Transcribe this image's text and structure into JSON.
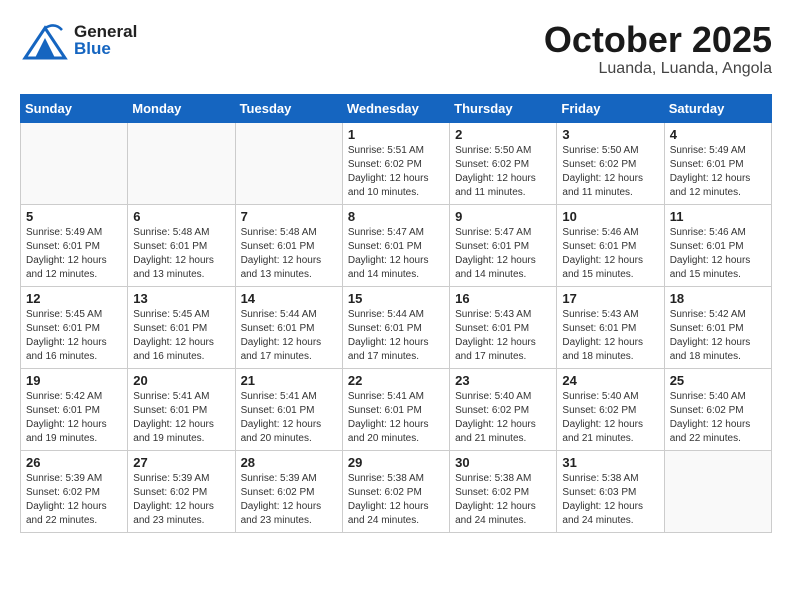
{
  "header": {
    "logo": {
      "general": "General",
      "blue": "Blue"
    },
    "title": "October 2025",
    "location": "Luanda, Luanda, Angola"
  },
  "weekdays": [
    "Sunday",
    "Monday",
    "Tuesday",
    "Wednesday",
    "Thursday",
    "Friday",
    "Saturday"
  ],
  "weeks": [
    [
      {
        "day": "",
        "sunrise": "",
        "sunset": "",
        "daylight": ""
      },
      {
        "day": "",
        "sunrise": "",
        "sunset": "",
        "daylight": ""
      },
      {
        "day": "",
        "sunrise": "",
        "sunset": "",
        "daylight": ""
      },
      {
        "day": "1",
        "sunrise": "Sunrise: 5:51 AM",
        "sunset": "Sunset: 6:02 PM",
        "daylight": "Daylight: 12 hours and 10 minutes."
      },
      {
        "day": "2",
        "sunrise": "Sunrise: 5:50 AM",
        "sunset": "Sunset: 6:02 PM",
        "daylight": "Daylight: 12 hours and 11 minutes."
      },
      {
        "day": "3",
        "sunrise": "Sunrise: 5:50 AM",
        "sunset": "Sunset: 6:02 PM",
        "daylight": "Daylight: 12 hours and 11 minutes."
      },
      {
        "day": "4",
        "sunrise": "Sunrise: 5:49 AM",
        "sunset": "Sunset: 6:01 PM",
        "daylight": "Daylight: 12 hours and 12 minutes."
      }
    ],
    [
      {
        "day": "5",
        "sunrise": "Sunrise: 5:49 AM",
        "sunset": "Sunset: 6:01 PM",
        "daylight": "Daylight: 12 hours and 12 minutes."
      },
      {
        "day": "6",
        "sunrise": "Sunrise: 5:48 AM",
        "sunset": "Sunset: 6:01 PM",
        "daylight": "Daylight: 12 hours and 13 minutes."
      },
      {
        "day": "7",
        "sunrise": "Sunrise: 5:48 AM",
        "sunset": "Sunset: 6:01 PM",
        "daylight": "Daylight: 12 hours and 13 minutes."
      },
      {
        "day": "8",
        "sunrise": "Sunrise: 5:47 AM",
        "sunset": "Sunset: 6:01 PM",
        "daylight": "Daylight: 12 hours and 14 minutes."
      },
      {
        "day": "9",
        "sunrise": "Sunrise: 5:47 AM",
        "sunset": "Sunset: 6:01 PM",
        "daylight": "Daylight: 12 hours and 14 minutes."
      },
      {
        "day": "10",
        "sunrise": "Sunrise: 5:46 AM",
        "sunset": "Sunset: 6:01 PM",
        "daylight": "Daylight: 12 hours and 15 minutes."
      },
      {
        "day": "11",
        "sunrise": "Sunrise: 5:46 AM",
        "sunset": "Sunset: 6:01 PM",
        "daylight": "Daylight: 12 hours and 15 minutes."
      }
    ],
    [
      {
        "day": "12",
        "sunrise": "Sunrise: 5:45 AM",
        "sunset": "Sunset: 6:01 PM",
        "daylight": "Daylight: 12 hours and 16 minutes."
      },
      {
        "day": "13",
        "sunrise": "Sunrise: 5:45 AM",
        "sunset": "Sunset: 6:01 PM",
        "daylight": "Daylight: 12 hours and 16 minutes."
      },
      {
        "day": "14",
        "sunrise": "Sunrise: 5:44 AM",
        "sunset": "Sunset: 6:01 PM",
        "daylight": "Daylight: 12 hours and 17 minutes."
      },
      {
        "day": "15",
        "sunrise": "Sunrise: 5:44 AM",
        "sunset": "Sunset: 6:01 PM",
        "daylight": "Daylight: 12 hours and 17 minutes."
      },
      {
        "day": "16",
        "sunrise": "Sunrise: 5:43 AM",
        "sunset": "Sunset: 6:01 PM",
        "daylight": "Daylight: 12 hours and 17 minutes."
      },
      {
        "day": "17",
        "sunrise": "Sunrise: 5:43 AM",
        "sunset": "Sunset: 6:01 PM",
        "daylight": "Daylight: 12 hours and 18 minutes."
      },
      {
        "day": "18",
        "sunrise": "Sunrise: 5:42 AM",
        "sunset": "Sunset: 6:01 PM",
        "daylight": "Daylight: 12 hours and 18 minutes."
      }
    ],
    [
      {
        "day": "19",
        "sunrise": "Sunrise: 5:42 AM",
        "sunset": "Sunset: 6:01 PM",
        "daylight": "Daylight: 12 hours and 19 minutes."
      },
      {
        "day": "20",
        "sunrise": "Sunrise: 5:41 AM",
        "sunset": "Sunset: 6:01 PM",
        "daylight": "Daylight: 12 hours and 19 minutes."
      },
      {
        "day": "21",
        "sunrise": "Sunrise: 5:41 AM",
        "sunset": "Sunset: 6:01 PM",
        "daylight": "Daylight: 12 hours and 20 minutes."
      },
      {
        "day": "22",
        "sunrise": "Sunrise: 5:41 AM",
        "sunset": "Sunset: 6:01 PM",
        "daylight": "Daylight: 12 hours and 20 minutes."
      },
      {
        "day": "23",
        "sunrise": "Sunrise: 5:40 AM",
        "sunset": "Sunset: 6:02 PM",
        "daylight": "Daylight: 12 hours and 21 minutes."
      },
      {
        "day": "24",
        "sunrise": "Sunrise: 5:40 AM",
        "sunset": "Sunset: 6:02 PM",
        "daylight": "Daylight: 12 hours and 21 minutes."
      },
      {
        "day": "25",
        "sunrise": "Sunrise: 5:40 AM",
        "sunset": "Sunset: 6:02 PM",
        "daylight": "Daylight: 12 hours and 22 minutes."
      }
    ],
    [
      {
        "day": "26",
        "sunrise": "Sunrise: 5:39 AM",
        "sunset": "Sunset: 6:02 PM",
        "daylight": "Daylight: 12 hours and 22 minutes."
      },
      {
        "day": "27",
        "sunrise": "Sunrise: 5:39 AM",
        "sunset": "Sunset: 6:02 PM",
        "daylight": "Daylight: 12 hours and 23 minutes."
      },
      {
        "day": "28",
        "sunrise": "Sunrise: 5:39 AM",
        "sunset": "Sunset: 6:02 PM",
        "daylight": "Daylight: 12 hours and 23 minutes."
      },
      {
        "day": "29",
        "sunrise": "Sunrise: 5:38 AM",
        "sunset": "Sunset: 6:02 PM",
        "daylight": "Daylight: 12 hours and 24 minutes."
      },
      {
        "day": "30",
        "sunrise": "Sunrise: 5:38 AM",
        "sunset": "Sunset: 6:02 PM",
        "daylight": "Daylight: 12 hours and 24 minutes."
      },
      {
        "day": "31",
        "sunrise": "Sunrise: 5:38 AM",
        "sunset": "Sunset: 6:03 PM",
        "daylight": "Daylight: 12 hours and 24 minutes."
      },
      {
        "day": "",
        "sunrise": "",
        "sunset": "",
        "daylight": ""
      }
    ]
  ]
}
